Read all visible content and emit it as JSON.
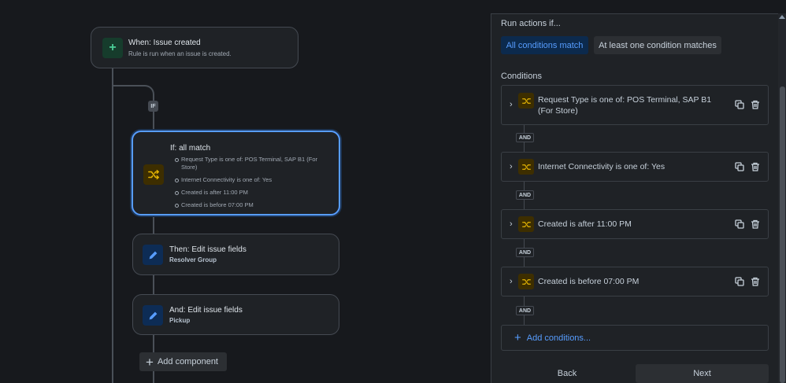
{
  "flow": {
    "trigger": {
      "title": "When: Issue created",
      "subtitle": "Rule is run when an issue is created."
    },
    "if_badge": "IF",
    "condition_block": {
      "title": "If: all match",
      "items": [
        "Request Type is one of: POS Terminal, SAP B1 (For Store)",
        "Internet Connectivity is one of: Yes",
        "Created is after 11:00 PM",
        "Created is before 07:00 PM"
      ]
    },
    "action1": {
      "title": "Then: Edit issue fields",
      "subtitle": "Resolver Group"
    },
    "action2": {
      "title": "And: Edit issue fields",
      "subtitle": "Pickup"
    },
    "add_component_label": "Add component"
  },
  "panel": {
    "run_actions_label": "Run actions if...",
    "match_options": {
      "all": "All conditions match",
      "any": "At least one condition matches",
      "selected": "all"
    },
    "conditions_label": "Conditions",
    "conditions": [
      "Request Type is one of: POS Terminal, SAP B1 (For Store)",
      "Internet Connectivity is one of: Yes",
      "Created is after 11:00 PM",
      "Created is before 07:00 PM"
    ],
    "connector_label": "AND",
    "add_conditions_label": "Add conditions...",
    "back_label": "Back",
    "next_label": "Next"
  },
  "colors": {
    "accent": "#579dff",
    "condition_icon": "#e2b203",
    "trigger_icon": "#4bce97"
  },
  "icons": {
    "trigger": "plus-icon",
    "condition": "shuffle-icon",
    "action": "pencil-icon",
    "copy": "copy-icon",
    "delete": "trash-icon",
    "expand": "chevron-right-icon"
  }
}
